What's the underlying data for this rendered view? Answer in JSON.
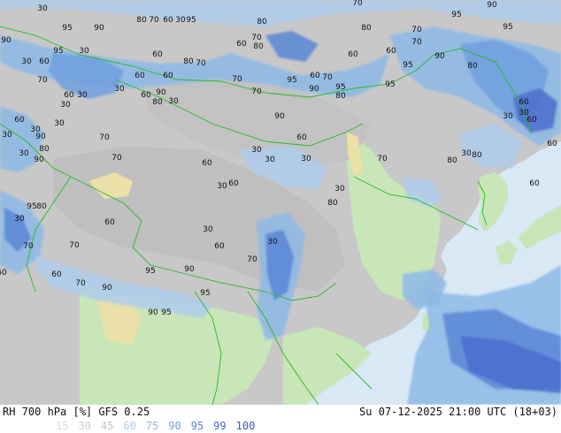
{
  "header": {
    "left": "RH 700 hPa [%] GFS 0.25",
    "right": "Su 07-12-2025 21:00 UTC (18+03)"
  },
  "legend": {
    "levels": [
      {
        "label": "15",
        "color": "#d8d8d8"
      },
      {
        "label": "30",
        "color": "#cfcfcf"
      },
      {
        "label": "45",
        "color": "#c6c6c6"
      },
      {
        "label": "60",
        "color": "#aeccec"
      },
      {
        "label": "75",
        "color": "#8db8e6"
      },
      {
        "label": "90",
        "color": "#6f9fdf"
      },
      {
        "label": "95",
        "color": "#5b86d6"
      },
      {
        "label": "99",
        "color": "#4a6ccc"
      },
      {
        "label": "100",
        "color": "#3b57c2"
      }
    ]
  },
  "map": {
    "colors": {
      "ocean": "#d8e8f5",
      "land_dry": "#c8c8c8",
      "desert": "#eae0a8",
      "green_land": "#c8e6b8",
      "border": "#22bb22"
    },
    "contour_labels": [
      "30",
      "95",
      "90",
      "80",
      "70",
      "60",
      "30",
      "95",
      "80",
      "70",
      "60",
      "80",
      "70",
      "95",
      "90",
      "95",
      "80",
      "70",
      "60",
      "95",
      "90",
      "80",
      "95",
      "70",
      "60",
      "60",
      "70",
      "90",
      "95",
      "80",
      "60",
      "80",
      "70",
      "60",
      "60",
      "90",
      "80",
      "70",
      "70",
      "95",
      "90",
      "90",
      "95",
      "30",
      "30",
      "60",
      "70",
      "60",
      "30",
      "30",
      "60",
      "30",
      "30",
      "90",
      "70",
      "30",
      "30",
      "60",
      "30",
      "30",
      "30",
      "30",
      "60",
      "70",
      "80",
      "60",
      "80",
      "30",
      "60",
      "30",
      "60",
      "30",
      "60",
      "30",
      "90",
      "80",
      "70",
      "60",
      "30",
      "80",
      "30",
      "60",
      "60",
      "70",
      "95",
      "80",
      "30",
      "70",
      "60",
      "60",
      "70",
      "90",
      "95",
      "90",
      "95",
      "90",
      "95",
      "30",
      "60",
      "70",
      "30"
    ]
  }
}
